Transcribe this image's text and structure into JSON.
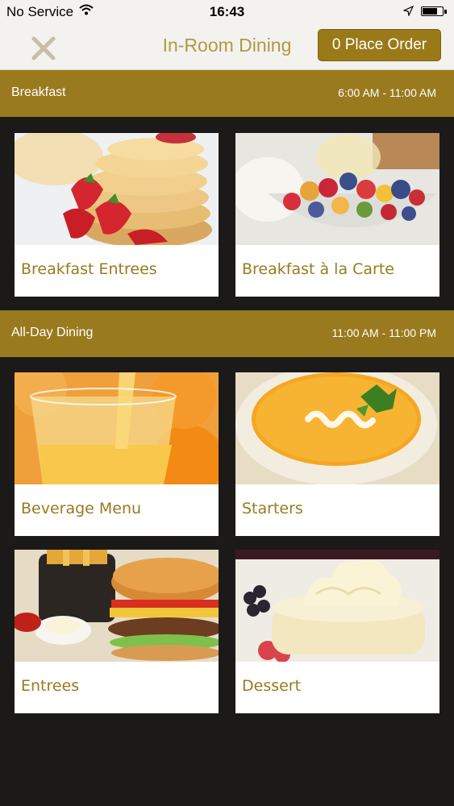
{
  "status_bar": {
    "carrier": "No Service",
    "time": "16:43"
  },
  "nav": {
    "title": "In-Room Dining",
    "order_label": "0 Place Order",
    "close_icon": "close-icon"
  },
  "sections": [
    {
      "name": "Breakfast",
      "hours": "6:00 AM - 11:00 AM",
      "cards": [
        {
          "label": "Breakfast Entrees",
          "image": "pancakes-strawberries-photo"
        },
        {
          "label": "Breakfast à la Carte",
          "image": "fruit-bowl-photo"
        }
      ]
    },
    {
      "name": "All-Day Dining",
      "hours": "11:00 AM - 11:00 PM",
      "cards": [
        {
          "label": "Beverage Menu",
          "image": "orange-juice-photo"
        },
        {
          "label": "Starters",
          "image": "soup-bowl-photo"
        },
        {
          "label": "Entrees",
          "image": "burger-fries-photo"
        },
        {
          "label": "Dessert",
          "image": "cheesecake-photo"
        }
      ]
    }
  ],
  "colors": {
    "accent": "#9a7a1e",
    "title": "#b09a45",
    "background": "#1b1a19",
    "navbar": "#f4f2ee"
  }
}
